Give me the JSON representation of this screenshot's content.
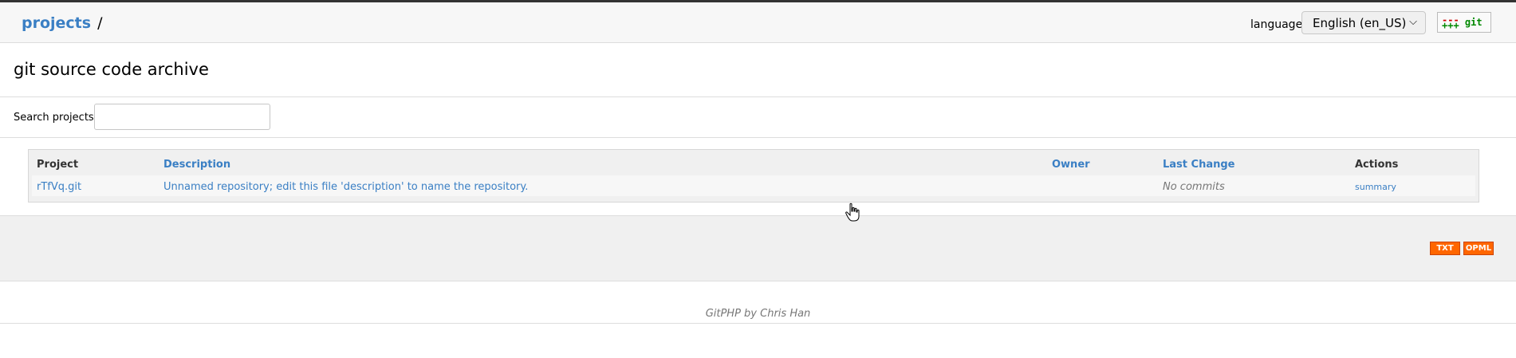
{
  "header": {
    "breadcrumb_link": "projects",
    "breadcrumb_sep": "/",
    "language_label": "language:",
    "language_value": "English (en_US)",
    "git_minus": "---",
    "git_plus": "+++",
    "git_word": "git"
  },
  "page": {
    "title": "git source code archive",
    "search_label": "Search projects:",
    "search_value": ""
  },
  "table": {
    "headers": {
      "project": "Project",
      "description": "Description",
      "owner": "Owner",
      "last_change": "Last Change",
      "actions": "Actions"
    },
    "rows": [
      {
        "project": "rTfVq.git",
        "description": "Unnamed repository; edit this file 'description' to name the repository.",
        "owner": "",
        "last_change": "No commits",
        "action": "summary"
      }
    ]
  },
  "footer": {
    "txt_badge": "TXT",
    "opml_badge": "OPML",
    "credit": "GitPHP by Chris Han"
  },
  "colors": {
    "link": "#3a7fc4",
    "badge": "#ff6600"
  }
}
